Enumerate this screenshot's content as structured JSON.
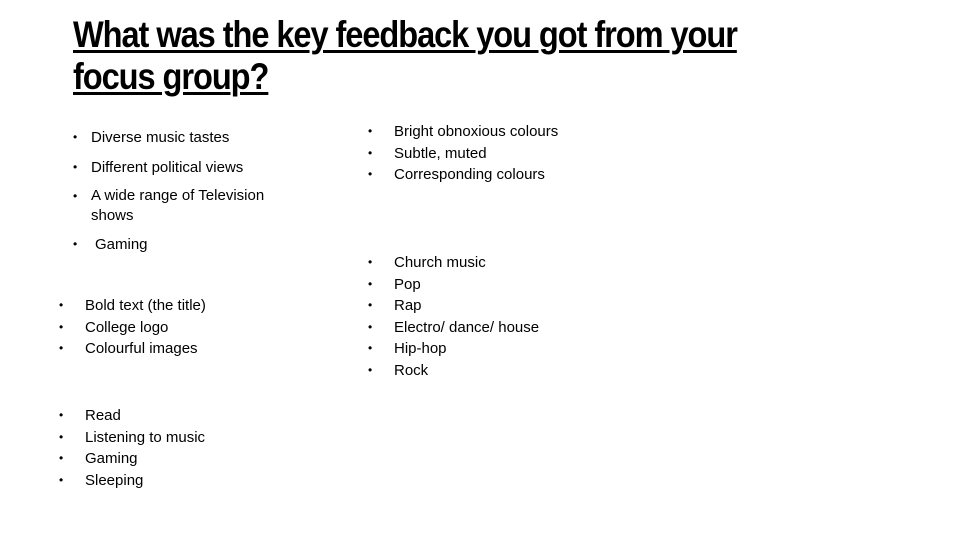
{
  "title": "What was the key feedback you got from your focus group?",
  "bullet_glyph": "•",
  "lists": {
    "audience": [
      "Diverse music tastes",
      "Different political views",
      "A wide range of Television shows",
      "Gaming"
    ],
    "design_elements": [
      "Bold text (the title)",
      "College logo",
      "Colourful images"
    ],
    "hobbies": [
      "Read",
      "Listening to music",
      "Gaming",
      "Sleeping"
    ],
    "colours": [
      "Bright obnoxious colours",
      "Subtle, muted",
      "Corresponding colours"
    ],
    "music_genres": [
      "Church music",
      "Pop",
      "Rap",
      "Electro/ dance/ house",
      "Hip-hop",
      "Rock"
    ]
  }
}
